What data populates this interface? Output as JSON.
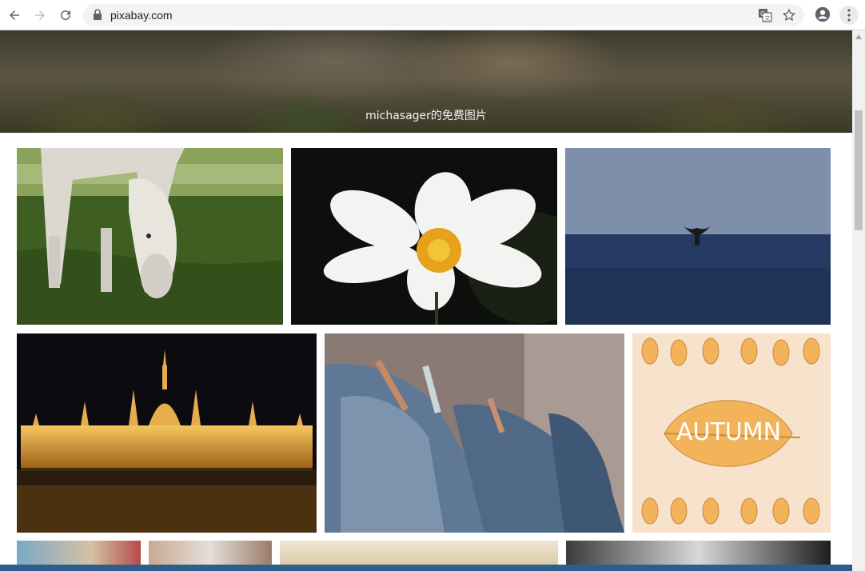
{
  "browser": {
    "url": "pixabay.com"
  },
  "banner": {
    "caption": "michasager的免费图片"
  },
  "gallery": {
    "items": [
      {
        "subject": "grazing white horse"
      },
      {
        "subject": "white cosmos flower"
      },
      {
        "subject": "whale tail in ocean"
      },
      {
        "subject": "parliament building at night"
      },
      {
        "subject": "jeans on clothesline"
      },
      {
        "subject": "autumn leaf illustration",
        "text": "AUTUMN"
      }
    ]
  },
  "colors": {
    "accent": "#2d5f8c",
    "omnibox_bg": "#f1f3f4"
  }
}
